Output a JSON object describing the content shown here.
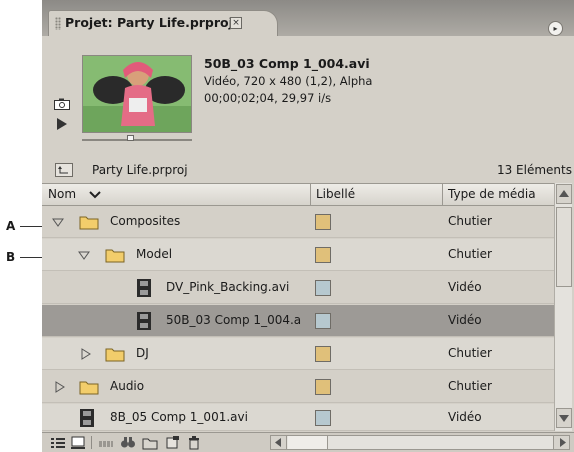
{
  "callouts": {
    "a": "A",
    "b": "B"
  },
  "panel": {
    "tab_title": "Projet: Party Life.prproj",
    "close_glyph": "×",
    "menu_glyph": "▸"
  },
  "preview": {
    "clip_name": "50B_03 Comp 1_004.avi",
    "line1": "Vidéo, 720 x 480 (1,2), Alpha",
    "line2": "00;00;02;04, 29,97 i/s"
  },
  "project": {
    "name": "Party Life.prproj",
    "items_count": "13 Eléments"
  },
  "columns": {
    "name": "Nom",
    "label": "Libellé",
    "media_type": "Type de média"
  },
  "colors": {
    "bin_label": "#e0c07a",
    "video_label": "#b6c8cf",
    "selected_row": "#9d9a96"
  },
  "rows": [
    {
      "name": "Composites",
      "type": "Chutier",
      "icon": "folder-icon",
      "expanded": true,
      "label_color": "#e0c07a"
    },
    {
      "name": "Model",
      "type": "Chutier",
      "icon": "folder-icon",
      "expanded": true,
      "label_color": "#e0c07a"
    },
    {
      "name": "DV_Pink_Backing.avi",
      "type": "Vidéo",
      "icon": "film-icon",
      "label_color": "#b6c8cf"
    },
    {
      "name": "50B_03 Comp 1_004.a",
      "type": "Vidéo",
      "icon": "film-icon",
      "selected": true,
      "label_color": "#b6c8cf"
    },
    {
      "name": "DJ",
      "type": "Chutier",
      "icon": "folder-icon",
      "expanded": false,
      "label_color": "#e0c07a"
    },
    {
      "name": "Audio",
      "type": "Chutier",
      "icon": "folder-icon",
      "expanded": false,
      "label_color": "#e0c07a"
    },
    {
      "name": "8B_05 Comp 1_001.avi",
      "type": "Vidéo",
      "icon": "film-icon",
      "label_color": "#b6c8cf"
    }
  ]
}
